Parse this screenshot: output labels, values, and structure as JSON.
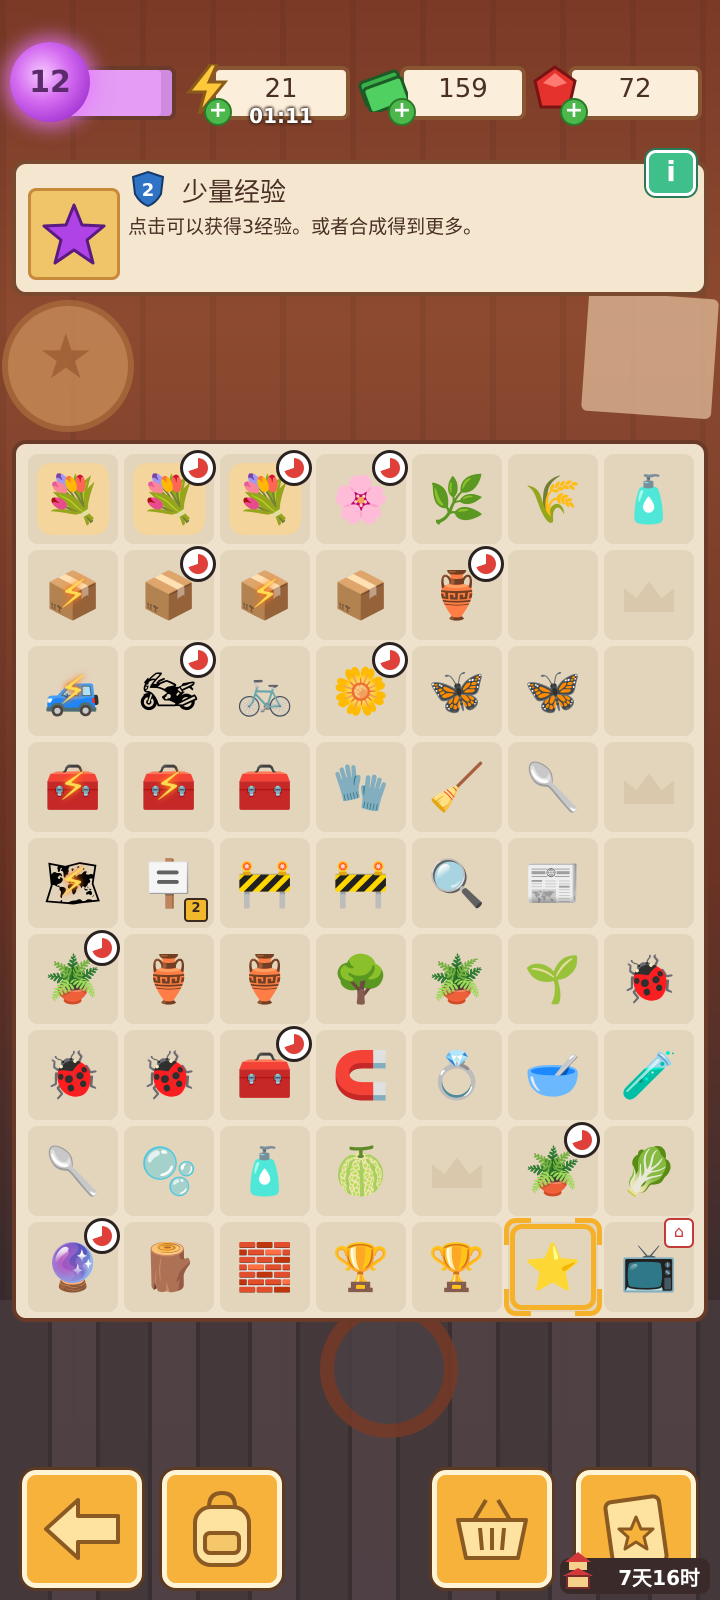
{
  "player": {
    "level": "12",
    "xp_fraction": 0.9
  },
  "resources": {
    "energy": {
      "value": "21",
      "timer": "01:11",
      "icon": "lightning-icon"
    },
    "cash": {
      "value": "159",
      "icon": "cash-stack-icon"
    },
    "gems": {
      "value": "72",
      "icon": "ruby-icon"
    }
  },
  "info_panel": {
    "item_level": "2",
    "title": "少量经验",
    "description": "点击可以获得3经验。或者合成得到更多。",
    "info_button": "i"
  },
  "board": {
    "cells": [
      {
        "icon": "flower-bed-icon",
        "glyph": "💐",
        "bg": "#f4d59b"
      },
      {
        "icon": "flower-bed-icon",
        "glyph": "💐",
        "bg": "#f4d59b",
        "timer": true
      },
      {
        "icon": "flower-bed-icon",
        "glyph": "💐",
        "bg": "#f4d59b",
        "timer": true
      },
      {
        "icon": "small-flower-bed-icon",
        "glyph": "🌸",
        "bg": "",
        "timer": true
      },
      {
        "icon": "shrub-icon",
        "glyph": "🌿",
        "bg": ""
      },
      {
        "icon": "seeds-icon",
        "glyph": "🌾",
        "bg": ""
      },
      {
        "icon": "oil-bottle-icon",
        "glyph": "🧴",
        "bg": ""
      },
      {
        "icon": "open-box-icon",
        "glyph": "📦",
        "bg": "",
        "bolt": true
      },
      {
        "icon": "box-of-dishes-icon",
        "glyph": "📦",
        "bg": "",
        "timer": true
      },
      {
        "icon": "open-box-icon",
        "glyph": "📦",
        "bg": "",
        "bolt": true
      },
      {
        "icon": "flat-boxes-icon",
        "glyph": "📦",
        "bg": ""
      },
      {
        "icon": "vase-icon",
        "glyph": "🏺",
        "bg": "",
        "timer": true
      },
      {
        "icon": "empty-slot",
        "glyph": "",
        "bg": ""
      },
      {
        "icon": "locked-slot",
        "glyph": "",
        "bg": "",
        "ghost": true
      },
      {
        "icon": "purple-car-icon",
        "glyph": "🚙",
        "bg": "",
        "bolt": true
      },
      {
        "icon": "motorcycle-icon",
        "glyph": "🏍",
        "bg": "",
        "timer": true
      },
      {
        "icon": "folding-bike-icon",
        "glyph": "🚲",
        "bg": ""
      },
      {
        "icon": "dandelion-icon",
        "glyph": "🌼",
        "bg": "",
        "timer": true
      },
      {
        "icon": "moth-icon",
        "glyph": "🦋",
        "bg": ""
      },
      {
        "icon": "butterfly-icon",
        "glyph": "🦋",
        "bg": ""
      },
      {
        "icon": "empty-slot",
        "glyph": "",
        "bg": ""
      },
      {
        "icon": "toolbox-pile-icon",
        "glyph": "🧰",
        "bg": "",
        "bolt": true
      },
      {
        "icon": "red-toolbox-icon",
        "glyph": "🧰",
        "bg": "",
        "bolt": true
      },
      {
        "icon": "closed-toolbox-icon",
        "glyph": "🧰",
        "bg": ""
      },
      {
        "icon": "work-gloves-icon",
        "glyph": "🧤",
        "bg": ""
      },
      {
        "icon": "brush-icon",
        "glyph": "🧹",
        "bg": ""
      },
      {
        "icon": "trowel-icon",
        "glyph": "🥄",
        "bg": ""
      },
      {
        "icon": "locked-slot",
        "glyph": "",
        "bg": "",
        "ghost": true
      },
      {
        "icon": "map-kit-icon",
        "glyph": "🗺",
        "bg": "",
        "bolt": true
      },
      {
        "icon": "sign-stand-icon",
        "glyph": "🪧",
        "bg": "",
        "tag": "2"
      },
      {
        "icon": "barrier-icon",
        "glyph": "🚧",
        "bg": ""
      },
      {
        "icon": "barrier-icon",
        "glyph": "🚧",
        "bg": ""
      },
      {
        "icon": "evidence-bag-icon",
        "glyph": "🔍",
        "bg": ""
      },
      {
        "icon": "newspaper-icon",
        "glyph": "📰",
        "bg": ""
      },
      {
        "icon": "empty-slot",
        "glyph": "",
        "bg": ""
      },
      {
        "icon": "herb-pot-icon",
        "glyph": "🪴",
        "bg": "",
        "timer": true
      },
      {
        "icon": "clay-pot-icon",
        "glyph": "🏺",
        "bg": ""
      },
      {
        "icon": "broken-pot-icon",
        "glyph": "🏺",
        "bg": ""
      },
      {
        "icon": "bonsai-icon",
        "glyph": "🌳",
        "bg": ""
      },
      {
        "icon": "sapling-pot-icon",
        "glyph": "🪴",
        "bg": ""
      },
      {
        "icon": "sprout-icon",
        "glyph": "🌱",
        "bg": ""
      },
      {
        "icon": "ladybug-pair-icon",
        "glyph": "🐞",
        "bg": ""
      },
      {
        "icon": "ladybug-icon",
        "glyph": "🐞",
        "bg": ""
      },
      {
        "icon": "ladybug-small-icon",
        "glyph": "🐞",
        "bg": ""
      },
      {
        "icon": "tool-case-icon",
        "glyph": "🧰",
        "bg": "",
        "timer": true
      },
      {
        "icon": "horseshoe-icon",
        "glyph": "🧲",
        "bg": ""
      },
      {
        "icon": "gold-ring-icon",
        "glyph": "💍",
        "bg": ""
      },
      {
        "icon": "bowl-icon",
        "glyph": "🥣",
        "bg": ""
      },
      {
        "icon": "green-bottle-icon",
        "glyph": "🧪",
        "bg": ""
      },
      {
        "icon": "slime-spoon-icon",
        "glyph": "🥄",
        "bg": ""
      },
      {
        "icon": "slime-blob-icon",
        "glyph": "🫧",
        "bg": ""
      },
      {
        "icon": "soap-bottle-icon",
        "glyph": "🧴",
        "bg": ""
      },
      {
        "icon": "melon-icon",
        "glyph": "🍈",
        "bg": ""
      },
      {
        "icon": "locked-slot",
        "glyph": "",
        "bg": "",
        "ghost": true
      },
      {
        "icon": "potted-plant-icon",
        "glyph": "🪴",
        "bg": "",
        "timer": true
      },
      {
        "icon": "leafy-bundle-icon",
        "glyph": "🥬",
        "bg": ""
      },
      {
        "icon": "snow-globe-stand-icon",
        "glyph": "🔮",
        "bg": "",
        "timer": true
      },
      {
        "icon": "broken-plank-icon",
        "glyph": "🪵",
        "bg": ""
      },
      {
        "icon": "brick-icon",
        "glyph": "🧱",
        "bg": ""
      },
      {
        "icon": "star-trophy-icon",
        "glyph": "🏆",
        "bg": ""
      },
      {
        "icon": "crystal-trophy-icon",
        "glyph": "🏆",
        "bg": ""
      },
      {
        "icon": "purple-star-icon",
        "glyph": "⭐",
        "bg": "",
        "selected": true
      },
      {
        "icon": "retro-tv-icon",
        "glyph": "📺",
        "bg": "",
        "gift": true
      }
    ]
  },
  "bottom_bar": {
    "back": {
      "icon": "back-arrow-icon",
      "glyph": "⬅"
    },
    "backpack": {
      "icon": "backpack-icon",
      "glyph": "🎒"
    },
    "shop": {
      "icon": "basket-icon",
      "glyph": "🧺"
    },
    "tasks": {
      "icon": "clipboard-star-icon",
      "glyph": "📋"
    },
    "event_timer": "7天16时",
    "event_icon": "pagoda-icon"
  }
}
